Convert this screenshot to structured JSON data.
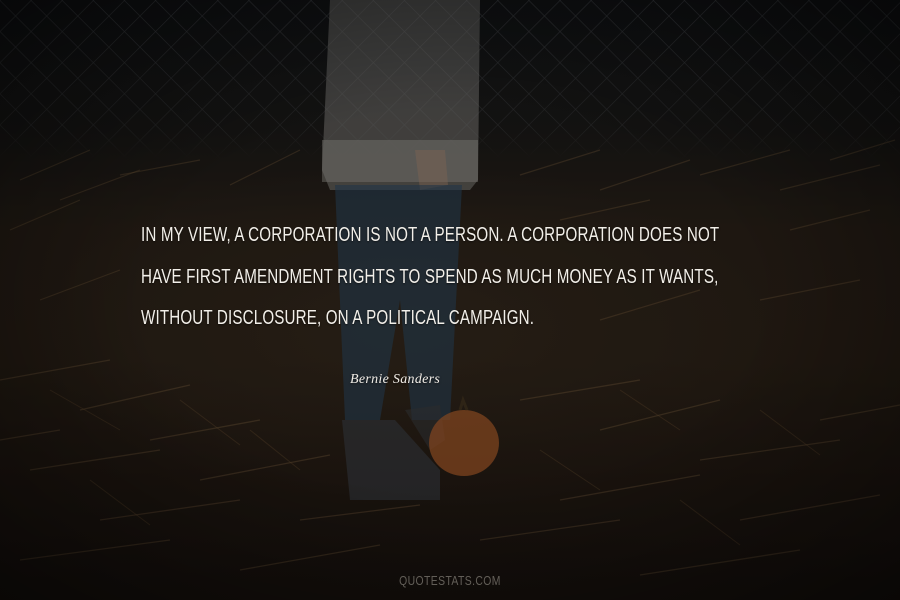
{
  "quote": {
    "lines": [
      "In my view, a corporation is not a person. A corporation does not",
      "have First Amendment rights to spend as much money as it wants,",
      "without disclosure, on a political campaign."
    ]
  },
  "author": "Bernie Sanders",
  "watermark": "QUOTESTATS.COM",
  "colors": {
    "text": "#f2efe9",
    "background": "#2a2118"
  }
}
